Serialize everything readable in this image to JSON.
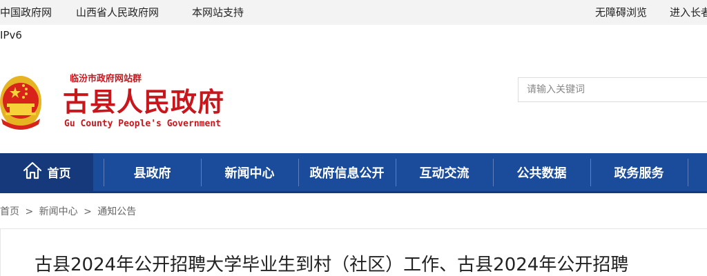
{
  "topbar": {
    "links": [
      "中国政府网",
      "山西省人民政府网",
      "本网站支持"
    ],
    "right_links": [
      "无障碍浏览",
      "进入长者"
    ]
  },
  "ipv6": "IPv6",
  "header": {
    "site_group": "临汾市政府网站群",
    "title": "古县人民政府",
    "english": "Gu County People's Government",
    "emblem_icon": "national-emblem-icon"
  },
  "search": {
    "placeholder": "请输入关键词"
  },
  "nav": {
    "home_label": "首页",
    "items": [
      "县政府",
      "新闻中心",
      "政府信息公开",
      "互动交流",
      "公共数据",
      "政务服务"
    ]
  },
  "breadcrumb": {
    "items": [
      "首页",
      "新闻中心",
      "通知公告"
    ],
    "separator": ">"
  },
  "article": {
    "title": "古县2024年公开招聘大学毕业生到村（社区）工作、古县2024年公开招聘"
  },
  "colors": {
    "brand_red": "#c8161d",
    "nav_blue": "#1b4c9c",
    "nav_home": "#15397a"
  }
}
